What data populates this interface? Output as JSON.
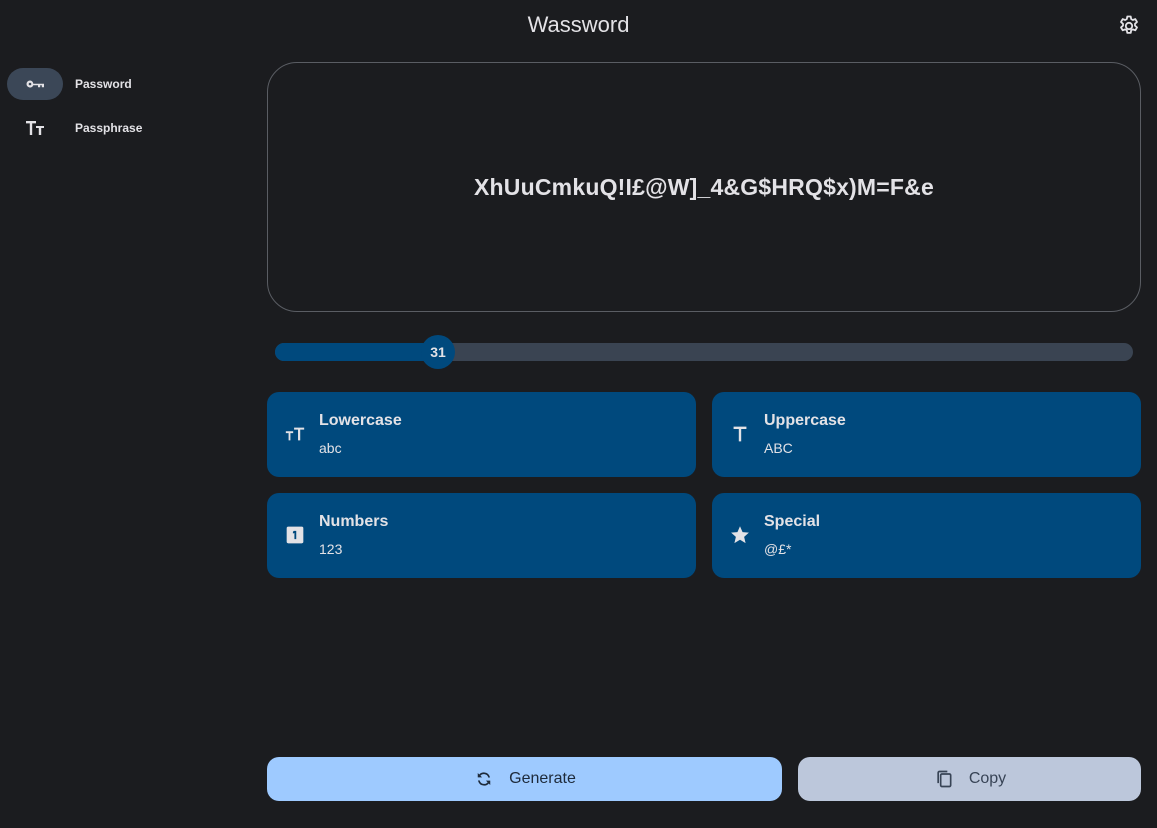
{
  "app": {
    "title": "Wassword"
  },
  "header": {
    "settings_icon": "gear-icon"
  },
  "nav": {
    "items": [
      {
        "label": "Password",
        "icon": "key-icon",
        "active": true
      },
      {
        "label": "Passphrase",
        "icon": "text-size-icon",
        "active": false
      }
    ]
  },
  "password": {
    "value": "XhUuCmkuQ!I£@W]_4&G$HRQ$x)M=F&e"
  },
  "length": {
    "value": 31,
    "fraction": 0.19
  },
  "options": [
    {
      "title": "Lowercase",
      "subtitle": "abc",
      "icon": "lowercase-icon"
    },
    {
      "title": "Uppercase",
      "subtitle": "ABC",
      "icon": "uppercase-icon"
    },
    {
      "title": "Numbers",
      "subtitle": "123",
      "icon": "numbers-icon"
    },
    {
      "title": "Special",
      "subtitle": "@£*",
      "icon": "star-icon"
    }
  ],
  "actions": {
    "generate_label": "Generate",
    "copy_label": "Copy"
  },
  "colors": {
    "background": "#1b1c1f",
    "card": "#00497d",
    "primary_button": "#9ecaff",
    "secondary_button": "#bcc7db"
  }
}
